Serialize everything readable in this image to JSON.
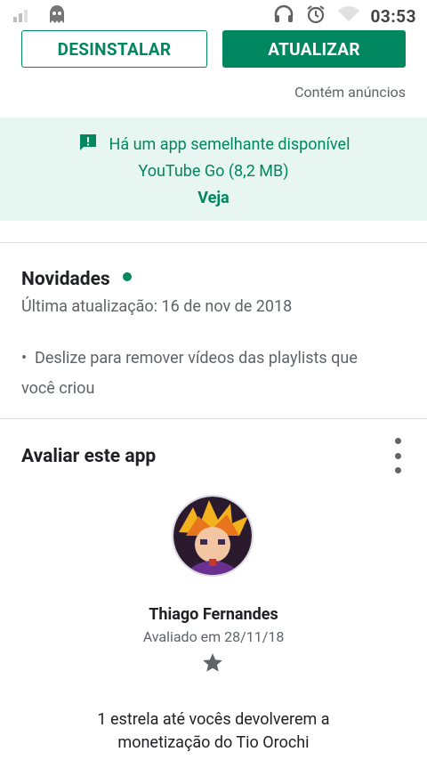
{
  "status_bar": {
    "time": "03:53",
    "icons": [
      "signal-icon",
      "ghost-icon",
      "headset-icon",
      "alarm-icon",
      "wifi-icon"
    ]
  },
  "actions": {
    "uninstall_label": "DESINSTALAR",
    "update_label": "ATUALIZAR",
    "ads_notice": "Contém anúncios"
  },
  "similar_app": {
    "message": "Há um app semelhante disponível",
    "app_name": "YouTube Go (8,2 MB)",
    "link_label": "Veja"
  },
  "whats_new": {
    "title": "Novidades",
    "last_update": "Última atualização: 16 de nov de 2018",
    "bullet": "•",
    "changes": "Deslize para remover vídeos das playlists que você criou"
  },
  "rate": {
    "title": "Avaliar este app",
    "reviewer_name": "Thiago Fernandes",
    "reviewed_on": "Avaliado em 28/11/18",
    "stars": 1,
    "review_text": "1 estrela até vocês devolverem a monetização do Tio Orochi"
  },
  "colors": {
    "accent": "#01875f",
    "banner_bg": "#e8f6f2",
    "secondary_text": "#5f6368"
  }
}
